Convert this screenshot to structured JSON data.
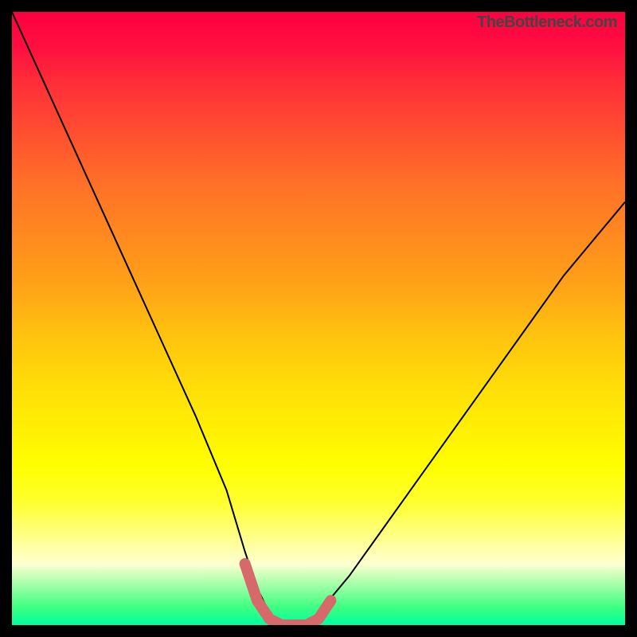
{
  "watermark": "TheBottleneck.com",
  "chart_data": {
    "type": "line",
    "title": "",
    "xlabel": "",
    "ylabel": "",
    "xlim": [
      0,
      100
    ],
    "ylim": [
      0,
      100
    ],
    "grid": false,
    "legend": false,
    "series": [
      {
        "name": "bottleneck-curve",
        "x": [
          0,
          5,
          10,
          15,
          20,
          25,
          30,
          35,
          38,
          40,
          42,
          44,
          46,
          48,
          50,
          55,
          60,
          65,
          70,
          75,
          80,
          85,
          90,
          95,
          100
        ],
        "y": [
          100,
          89,
          78,
          67,
          56,
          45,
          34,
          22,
          12,
          6,
          2,
          0,
          0,
          0,
          2,
          8,
          15,
          22,
          29,
          36,
          43,
          50,
          57,
          63,
          69
        ]
      }
    ],
    "highlight": {
      "name": "optimal-range",
      "x": [
        38,
        40,
        42,
        44,
        46,
        48,
        50,
        52
      ],
      "y": [
        10,
        4,
        1,
        0,
        0,
        0,
        1,
        4
      ]
    },
    "gradient_colors": {
      "top": "#ff0040",
      "upper_mid": "#ff8820",
      "mid": "#ffff00",
      "lower_mid": "#ffff80",
      "bottom": "#00ffa0"
    }
  }
}
